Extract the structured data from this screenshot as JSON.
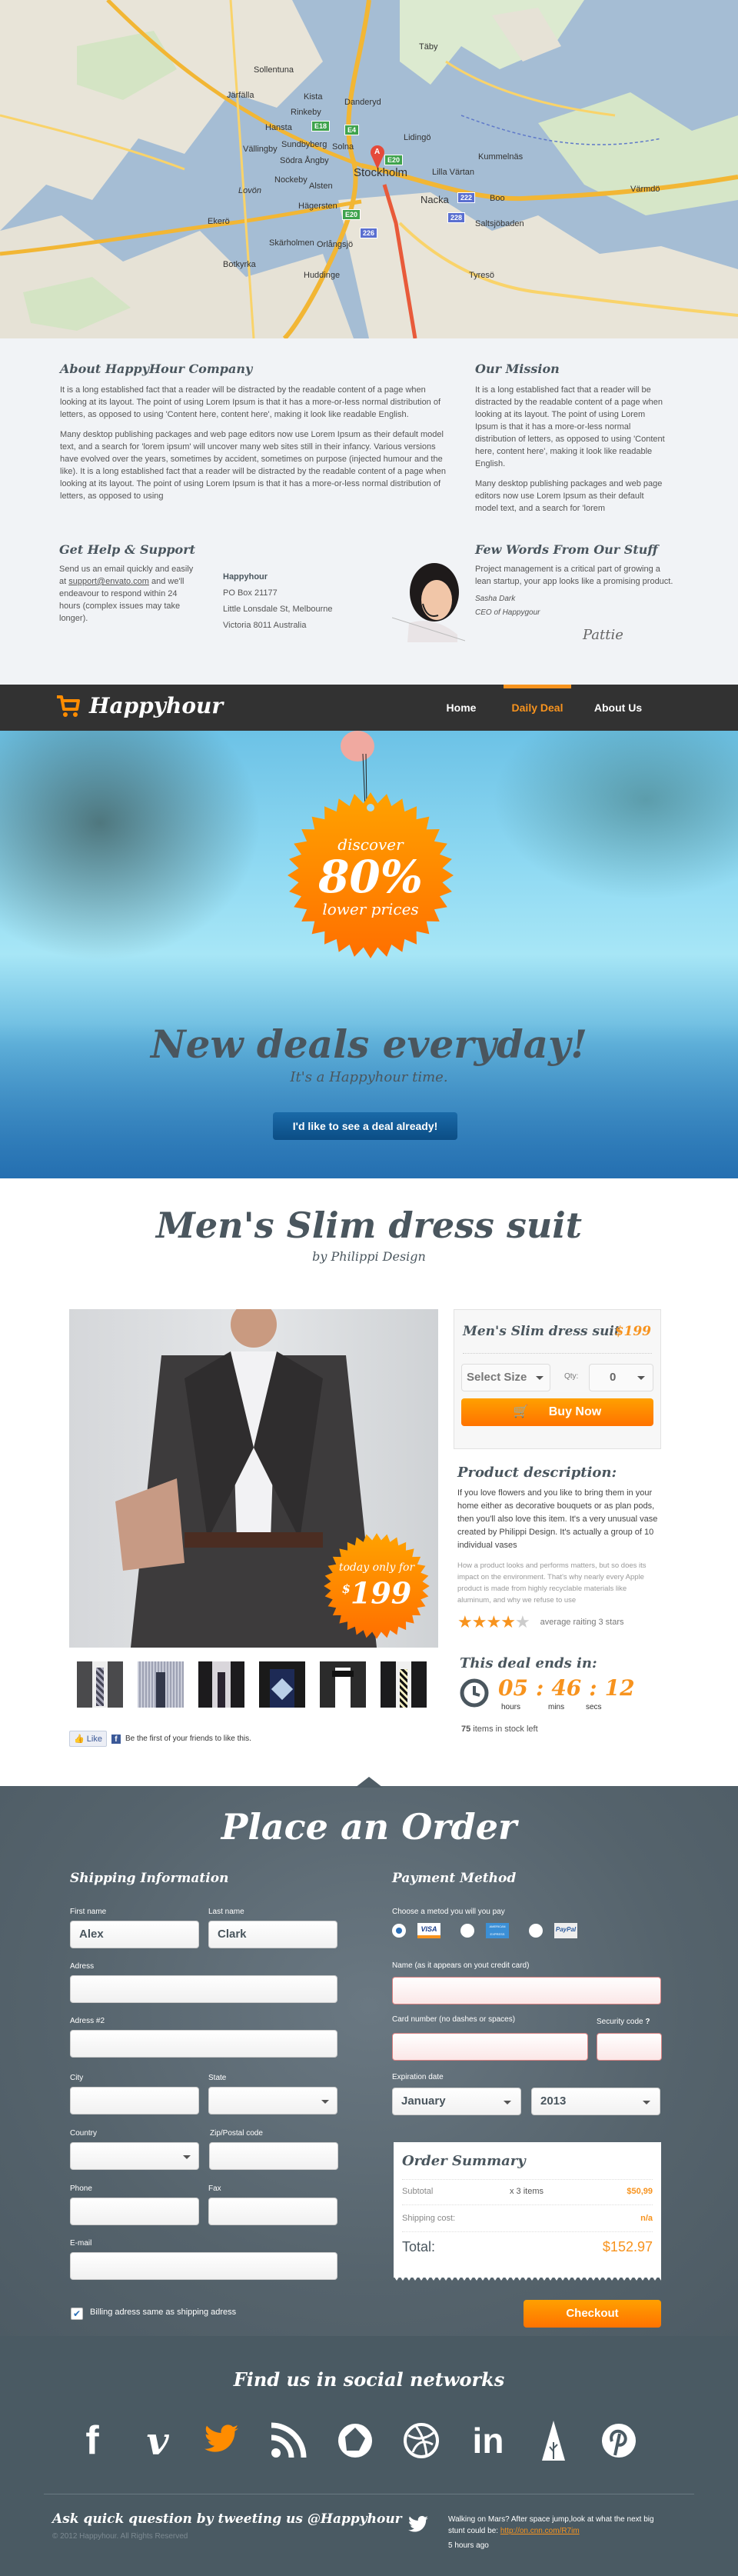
{
  "map": {
    "labels": [
      "Täby",
      "Sollentuna",
      "Järfälla",
      "Kista",
      "Danderyd",
      "Rinkeby",
      "Hansta",
      "Sundbyberg",
      "Solna",
      "Lidingö",
      "Vällingby",
      "Södra Ångby",
      "Nockeby",
      "Lovön",
      "Alsten",
      "Hägersten",
      "Kummelnäs",
      "Lilla Värtan",
      "Nacka",
      "Boo",
      "Saltsjöbaden",
      "Skärholmen",
      "Orlångsjö",
      "Tyresö",
      "Huddinge",
      "Botkyrka",
      "Värmdö",
      "Ekerö"
    ],
    "marker_label": "A",
    "marker_place": "Stockholm",
    "shields": [
      "E18",
      "E4",
      "E20",
      "E20",
      "222",
      "228",
      "226"
    ]
  },
  "about": {
    "title": "About HappyHour Company",
    "p1": "It is a long established fact that a reader will be distracted by the readable content of a page when looking at its layout. The point of using Lorem Ipsum is that it has a more-or-less normal distribution of letters, as opposed to using 'Content here, content here', making it look like readable English.",
    "p2": "Many desktop publishing packages and web page editors now use Lorem Ipsum as their default model text, and a search for 'lorem ipsum' will uncover many web sites still in their infancy. Various versions have evolved over the years, sometimes by accident, sometimes on purpose (injected humour and the like). It is a long established fact that a reader will be distracted by the readable content of a page when looking at its layout. The point of using Lorem Ipsum is that it has a more-or-less normal distribution of letters, as opposed to using"
  },
  "mission": {
    "title": "Our Mission",
    "p1": "It is a long established fact that a reader will be distracted by the readable content of a page when looking at its layout. The point of using Lorem Ipsum is that it has a more-or-less normal distribution of letters, as opposed to using 'Content here, content here', making it look like readable English.",
    "p2": "Many desktop publishing packages and web page editors now use Lorem Ipsum as their default model text, and a search for 'lorem"
  },
  "help": {
    "title": "Get Help & Support",
    "text_before": "Send us an email quickly and easily at ",
    "email": "support@envato.com",
    "text_after": " and we'll endeavour to respond within 24 hours (complex issues may take longer).",
    "company": "Happyhour",
    "address1": "PO Box 21177",
    "address2": "Little Lonsdale St, Melbourne",
    "address3": "Victoria 8011 Australia"
  },
  "staff": {
    "title": "Few Words From Our Stuff",
    "quote": "Project management is a critical part of growing a lean startup, your app looks like a promising product.",
    "name": "Sasha Dark",
    "role": "CEO of Happygour",
    "signature": "Pattie"
  },
  "nav": {
    "brand": "Happyhour",
    "items": [
      {
        "label": "Home",
        "active": false
      },
      {
        "label": "Daily Deal",
        "active": true
      },
      {
        "label": "About Us",
        "active": false
      }
    ],
    "accent": "#f7931e"
  },
  "hero": {
    "badge_top": "discover",
    "badge_value": "80%",
    "badge_bottom": "lower prices",
    "headline": "New deals everyday!",
    "subline": "It's a Happyhour time.",
    "cta": "I'd like to see a deal already!"
  },
  "product": {
    "title": "Men's Slim dress suit",
    "by": "by Philippi Design",
    "badge_top": "today only for",
    "badge_currency": "$",
    "badge_price": "199",
    "thumbnails": [
      "grey-suit-striped-tie",
      "striped-shirt-tie",
      "black-suit-dark-tie",
      "argyle-sweater",
      "tuxedo-bowtie",
      "black-suit-yellow-tie"
    ],
    "fb_like": "Like",
    "fb_text": "Be the first of your friends to like this.",
    "box": {
      "title": "Men's Slim dress suit",
      "price": "$199",
      "size_select": "Select Size",
      "qty_label": "Qty:",
      "qty_value": "0",
      "buy_label": "Buy Now"
    },
    "description": {
      "title": "Product description:",
      "p1": "If you love flowers and you like to bring them in your home either as decorative bouquets or as plan pods, then you'll also love this item. It's a very unusual vase created by Philippi Design. It's actually a group of 10 individual vases",
      "p2": "How a product looks and performs matters, but so does its impact on the environment. That's why nearly every Apple product is made from highly recyclable materials like aluminum, and why we refuse to use"
    },
    "rating": {
      "filled": 4,
      "total": 5,
      "label": "average raiting 3 stars"
    },
    "deal": {
      "title": "This deal ends in:",
      "hours": "05",
      "mins": "46",
      "secs": "12",
      "hours_label": "hours",
      "mins_label": "mins",
      "secs_label": "secs",
      "stock_count": "75",
      "stock_text": " items in stock left"
    }
  },
  "order": {
    "title": "Place an Order",
    "shipping": {
      "title": "Shipping Information",
      "first_name_label": "First name",
      "first_name": "Alex",
      "last_name_label": "Last name",
      "last_name": "Clark",
      "address_label": "Adress",
      "address": "",
      "address2_label": "Adress #2",
      "address2": "",
      "city_label": "City",
      "city": "",
      "state_label": "State",
      "state": "",
      "country_label": "Country",
      "country": "",
      "zip_label": "Zip/Postal code",
      "zip": "",
      "phone_label": "Phone",
      "phone": "",
      "fax_label": "Fax",
      "fax": "",
      "email_label": "E-mail",
      "email": "",
      "billing_same_label": "Billing adress same as shipping adress",
      "billing_same_checked": true
    },
    "payment": {
      "title": "Payment Method",
      "choose_label": "Choose a metod you will you pay",
      "methods": [
        {
          "name": "VISA",
          "selected": true
        },
        {
          "name": "AMERICAN EXPRESS",
          "selected": false
        },
        {
          "name": "PayPal",
          "selected": false
        }
      ],
      "card_name_label": "Name (as it appears on yout credit card)",
      "card_number_label": "Card number (no dashes or spaces)",
      "security_label": "Security code",
      "security_help": "?",
      "expiration_label": "Expiration date",
      "exp_month": "January",
      "exp_year": "2013"
    },
    "summary": {
      "title": "Order Summary",
      "subtotal_label": "Subtotal",
      "subtotal_qty": "x 3 items",
      "subtotal_value": "$50,99",
      "shipping_label": "Shipping cost:",
      "shipping_value": "n/a",
      "total_label": "Total:",
      "total_value": "$152.97"
    },
    "checkout": "Checkout"
  },
  "social": {
    "title": "Find us in social networks",
    "icons": [
      "facebook",
      "vimeo",
      "twitter",
      "rss",
      "picasa",
      "dribbble",
      "linkedin",
      "forrst",
      "pinterest"
    ],
    "highlight": "twitter"
  },
  "footer": {
    "ask": "Ask quick question by tweeting us @Happyhour",
    "copyright": "© 2012 Happyhour. All Rights Reserved",
    "tweet_text": "Walking on Mars? After space jump,look at what the next big stunt could be: ",
    "tweet_link": "http://on.cnn.com/R7im",
    "tweet_time": "5 hours ago"
  }
}
